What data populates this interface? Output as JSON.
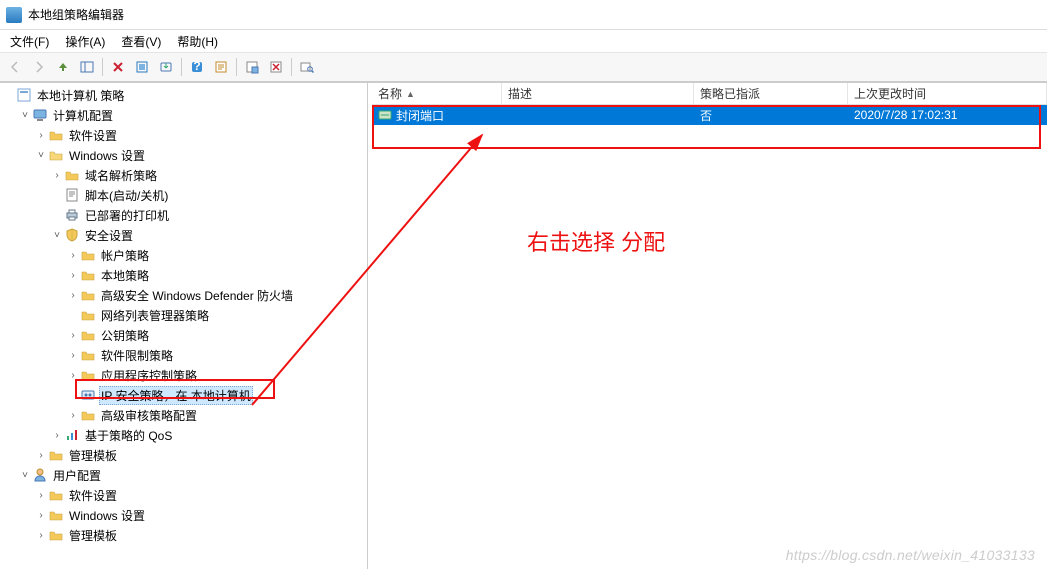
{
  "window": {
    "title": "本地组策略编辑器"
  },
  "menu": {
    "file": "文件(F)",
    "action": "操作(A)",
    "view": "查看(V)",
    "help": "帮助(H)"
  },
  "toolbar_icons": [
    "back",
    "forward",
    "up",
    "show-hide",
    "delete",
    "refresh",
    "export",
    "properties",
    "help-icon",
    "filter",
    "stop",
    "find"
  ],
  "tree": {
    "root": "本地计算机 策略",
    "computer_cfg": "计算机配置",
    "software_settings": "软件设置",
    "windows_settings": "Windows 设置",
    "dns_policy": "域名解析策略",
    "scripts": "脚本(启动/关机)",
    "deployed_printers": "已部署的打印机",
    "security_settings": "安全设置",
    "account_policy": "帐户策略",
    "local_policy": "本地策略",
    "defender_fw": "高级安全 Windows Defender 防火墙",
    "netlist_mgr": "网络列表管理器策略",
    "pubkey_policy": "公钥策略",
    "software_restrict": "软件限制策略",
    "app_control": "应用程序控制策略",
    "ip_sec": "IP 安全策略，在 本地计算机",
    "adv_audit": "高级审核策略配置",
    "qos": "基于策略的 QoS",
    "admin_templates": "管理模板",
    "user_cfg": "用户配置",
    "u_software_settings": "软件设置",
    "u_windows_settings": "Windows 设置",
    "u_admin_templates": "管理模板"
  },
  "list": {
    "columns": {
      "name": "名称",
      "desc": "描述",
      "assigned": "策略已指派",
      "last_change": "上次更改时间"
    },
    "rows": [
      {
        "name": "封闭端口",
        "desc": "",
        "assigned": "否",
        "last_change": "2020/7/28 17:02:31"
      }
    ]
  },
  "annotation": {
    "instruction": "右击选择 分配"
  },
  "colwidths": {
    "name": 130,
    "desc": 192,
    "assigned": 154,
    "last_change": 200
  },
  "watermark": "https://blog.csdn.net/weixin_41033133"
}
